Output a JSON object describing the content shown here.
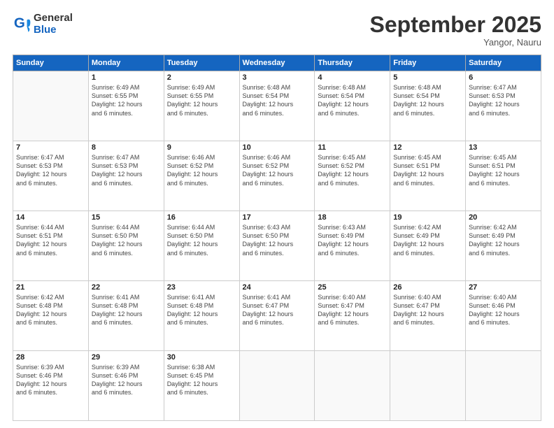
{
  "logo": {
    "general": "General",
    "blue": "Blue"
  },
  "header": {
    "month": "September 2025",
    "location": "Yangor, Nauru"
  },
  "days_of_week": [
    "Sunday",
    "Monday",
    "Tuesday",
    "Wednesday",
    "Thursday",
    "Friday",
    "Saturday"
  ],
  "weeks": [
    [
      {
        "day": "",
        "info": ""
      },
      {
        "day": "1",
        "info": "Sunrise: 6:49 AM\nSunset: 6:55 PM\nDaylight: 12 hours\nand 6 minutes."
      },
      {
        "day": "2",
        "info": "Sunrise: 6:49 AM\nSunset: 6:55 PM\nDaylight: 12 hours\nand 6 minutes."
      },
      {
        "day": "3",
        "info": "Sunrise: 6:48 AM\nSunset: 6:54 PM\nDaylight: 12 hours\nand 6 minutes."
      },
      {
        "day": "4",
        "info": "Sunrise: 6:48 AM\nSunset: 6:54 PM\nDaylight: 12 hours\nand 6 minutes."
      },
      {
        "day": "5",
        "info": "Sunrise: 6:48 AM\nSunset: 6:54 PM\nDaylight: 12 hours\nand 6 minutes."
      },
      {
        "day": "6",
        "info": "Sunrise: 6:47 AM\nSunset: 6:53 PM\nDaylight: 12 hours\nand 6 minutes."
      }
    ],
    [
      {
        "day": "7",
        "info": "Sunrise: 6:47 AM\nSunset: 6:53 PM\nDaylight: 12 hours\nand 6 minutes."
      },
      {
        "day": "8",
        "info": "Sunrise: 6:47 AM\nSunset: 6:53 PM\nDaylight: 12 hours\nand 6 minutes."
      },
      {
        "day": "9",
        "info": "Sunrise: 6:46 AM\nSunset: 6:52 PM\nDaylight: 12 hours\nand 6 minutes."
      },
      {
        "day": "10",
        "info": "Sunrise: 6:46 AM\nSunset: 6:52 PM\nDaylight: 12 hours\nand 6 minutes."
      },
      {
        "day": "11",
        "info": "Sunrise: 6:45 AM\nSunset: 6:52 PM\nDaylight: 12 hours\nand 6 minutes."
      },
      {
        "day": "12",
        "info": "Sunrise: 6:45 AM\nSunset: 6:51 PM\nDaylight: 12 hours\nand 6 minutes."
      },
      {
        "day": "13",
        "info": "Sunrise: 6:45 AM\nSunset: 6:51 PM\nDaylight: 12 hours\nand 6 minutes."
      }
    ],
    [
      {
        "day": "14",
        "info": "Sunrise: 6:44 AM\nSunset: 6:51 PM\nDaylight: 12 hours\nand 6 minutes."
      },
      {
        "day": "15",
        "info": "Sunrise: 6:44 AM\nSunset: 6:50 PM\nDaylight: 12 hours\nand 6 minutes."
      },
      {
        "day": "16",
        "info": "Sunrise: 6:44 AM\nSunset: 6:50 PM\nDaylight: 12 hours\nand 6 minutes."
      },
      {
        "day": "17",
        "info": "Sunrise: 6:43 AM\nSunset: 6:50 PM\nDaylight: 12 hours\nand 6 minutes."
      },
      {
        "day": "18",
        "info": "Sunrise: 6:43 AM\nSunset: 6:49 PM\nDaylight: 12 hours\nand 6 minutes."
      },
      {
        "day": "19",
        "info": "Sunrise: 6:42 AM\nSunset: 6:49 PM\nDaylight: 12 hours\nand 6 minutes."
      },
      {
        "day": "20",
        "info": "Sunrise: 6:42 AM\nSunset: 6:49 PM\nDaylight: 12 hours\nand 6 minutes."
      }
    ],
    [
      {
        "day": "21",
        "info": "Sunrise: 6:42 AM\nSunset: 6:48 PM\nDaylight: 12 hours\nand 6 minutes."
      },
      {
        "day": "22",
        "info": "Sunrise: 6:41 AM\nSunset: 6:48 PM\nDaylight: 12 hours\nand 6 minutes."
      },
      {
        "day": "23",
        "info": "Sunrise: 6:41 AM\nSunset: 6:48 PM\nDaylight: 12 hours\nand 6 minutes."
      },
      {
        "day": "24",
        "info": "Sunrise: 6:41 AM\nSunset: 6:47 PM\nDaylight: 12 hours\nand 6 minutes."
      },
      {
        "day": "25",
        "info": "Sunrise: 6:40 AM\nSunset: 6:47 PM\nDaylight: 12 hours\nand 6 minutes."
      },
      {
        "day": "26",
        "info": "Sunrise: 6:40 AM\nSunset: 6:47 PM\nDaylight: 12 hours\nand 6 minutes."
      },
      {
        "day": "27",
        "info": "Sunrise: 6:40 AM\nSunset: 6:46 PM\nDaylight: 12 hours\nand 6 minutes."
      }
    ],
    [
      {
        "day": "28",
        "info": "Sunrise: 6:39 AM\nSunset: 6:46 PM\nDaylight: 12 hours\nand 6 minutes."
      },
      {
        "day": "29",
        "info": "Sunrise: 6:39 AM\nSunset: 6:46 PM\nDaylight: 12 hours\nand 6 minutes."
      },
      {
        "day": "30",
        "info": "Sunrise: 6:38 AM\nSunset: 6:45 PM\nDaylight: 12 hours\nand 6 minutes."
      },
      {
        "day": "",
        "info": ""
      },
      {
        "day": "",
        "info": ""
      },
      {
        "day": "",
        "info": ""
      },
      {
        "day": "",
        "info": ""
      }
    ]
  ]
}
